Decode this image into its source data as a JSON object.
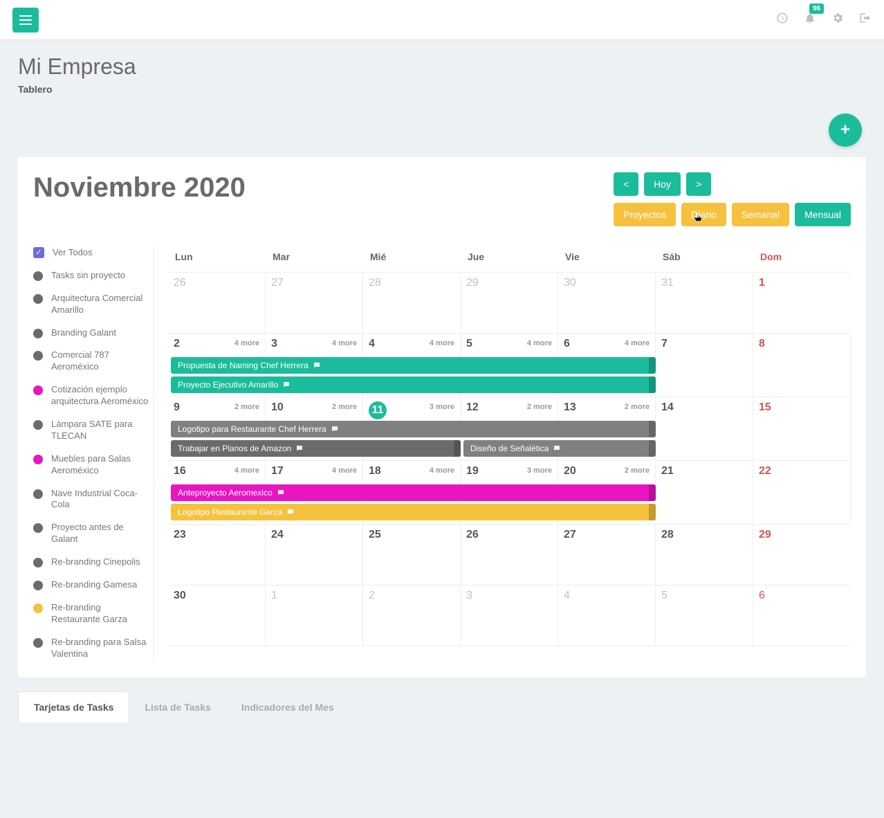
{
  "topbar": {
    "notification_count": "96"
  },
  "page": {
    "title": "Mi Empresa",
    "subtitle": "Tablero"
  },
  "calendar": {
    "title": "Noviembre 2020",
    "nav": {
      "prev": "<",
      "today": "Hoy",
      "next": ">"
    },
    "views": {
      "projects": "Proyectos",
      "daily": "Diario",
      "weekly": "Semanal",
      "monthly": "Mensual"
    },
    "dow": [
      "Lun",
      "Mar",
      "Mié",
      "Jue",
      "Vie",
      "Sáb",
      "Dom"
    ],
    "more_suffix": " more"
  },
  "projects": {
    "view_all": "Ver Todos",
    "items": [
      {
        "label": "Tasks sin proyecto",
        "color": "#6b6b6b"
      },
      {
        "label": "Arquitectura Comercial Amarillo",
        "color": "#6b6b6b"
      },
      {
        "label": "Branding Galant",
        "color": "#6b6b6b"
      },
      {
        "label": "Comercial 787 Aeroméxico",
        "color": "#6b6b6b"
      },
      {
        "label": "Cotización ejemplo arquitectura Aeroméxico",
        "color": "#e815c0"
      },
      {
        "label": "Lámpara SATE para TLECAN",
        "color": "#6b6b6b"
      },
      {
        "label": "Muebles para Salas Aeroméxico",
        "color": "#e815c0"
      },
      {
        "label": "Nave Industrial Coca-Cola",
        "color": "#6b6b6b"
      },
      {
        "label": "Proyecto antes de Galant",
        "color": "#6b6b6b"
      },
      {
        "label": "Re-branding Cinepolis",
        "color": "#6b6b6b"
      },
      {
        "label": "Re-branding Gamesa",
        "color": "#6b6b6b"
      },
      {
        "label": "Re-branding Restaurante Garza",
        "color": "#f6c23e"
      },
      {
        "label": "Re-branding para Salsa Valentina",
        "color": "#6b6b6b"
      }
    ]
  },
  "weeks": [
    {
      "days": [
        {
          "n": "26",
          "outside": true
        },
        {
          "n": "27",
          "outside": true
        },
        {
          "n": "28",
          "outside": true
        },
        {
          "n": "29",
          "outside": true
        },
        {
          "n": "30",
          "outside": true
        },
        {
          "n": "31",
          "outside": true
        },
        {
          "n": "1",
          "sunday": true
        }
      ],
      "events": []
    },
    {
      "days": [
        {
          "n": "2",
          "more": "4"
        },
        {
          "n": "3",
          "more": "4"
        },
        {
          "n": "4",
          "more": "4"
        },
        {
          "n": "5",
          "more": "4"
        },
        {
          "n": "6",
          "more": "4"
        },
        {
          "n": "7"
        },
        {
          "n": "8",
          "sunday": true
        }
      ],
      "events": [
        {
          "label": "Propuesta de Naming Chef Herrera",
          "color": "#1bbc9b",
          "start": 0,
          "span": 5
        },
        {
          "label": "Proyecto Ejecutivo Amarillo",
          "color": "#1bbc9b",
          "start": 0,
          "span": 5
        }
      ]
    },
    {
      "days": [
        {
          "n": "9",
          "more": "2"
        },
        {
          "n": "10",
          "more": "2"
        },
        {
          "n": "11",
          "more": "3",
          "today": true
        },
        {
          "n": "12",
          "more": "2"
        },
        {
          "n": "13",
          "more": "2"
        },
        {
          "n": "14"
        },
        {
          "n": "15",
          "sunday": true
        }
      ],
      "events": [
        {
          "label": "Logotipo para Restaurante Chef Herrera",
          "color": "#808080",
          "start": 0,
          "span": 5
        },
        {
          "label": "Trabajar en Planos de Amazon",
          "color": "#6b6b6b",
          "start": 0,
          "span": 3
        },
        {
          "label": "Diseño de Señalética",
          "color": "#808080",
          "start": 3,
          "span": 2,
          "row": 1
        }
      ]
    },
    {
      "days": [
        {
          "n": "16",
          "more": "4"
        },
        {
          "n": "17",
          "more": "4"
        },
        {
          "n": "18",
          "more": "4"
        },
        {
          "n": "19",
          "more": "3"
        },
        {
          "n": "20",
          "more": "2"
        },
        {
          "n": "21"
        },
        {
          "n": "22",
          "sunday": true
        }
      ],
      "events": [
        {
          "label": "Anteproyecto Aeromexico",
          "color": "#e815c0",
          "start": 0,
          "span": 5
        },
        {
          "label": "Logotipo Restaurante Garza",
          "color": "#f6c23e",
          "start": 0,
          "span": 5
        }
      ]
    },
    {
      "days": [
        {
          "n": "23"
        },
        {
          "n": "24"
        },
        {
          "n": "25"
        },
        {
          "n": "26"
        },
        {
          "n": "27"
        },
        {
          "n": "28"
        },
        {
          "n": "29",
          "sunday": true
        }
      ],
      "events": []
    },
    {
      "days": [
        {
          "n": "30"
        },
        {
          "n": "1",
          "outside": true
        },
        {
          "n": "2",
          "outside": true
        },
        {
          "n": "3",
          "outside": true
        },
        {
          "n": "4",
          "outside": true
        },
        {
          "n": "5",
          "outside": true
        },
        {
          "n": "6",
          "outside": true,
          "sunday": true
        }
      ],
      "events": []
    }
  ],
  "tabs": {
    "cards": "Tarjetas de Tasks",
    "list": "Lista de Tasks",
    "indicators": "Indicadores del Mes"
  }
}
